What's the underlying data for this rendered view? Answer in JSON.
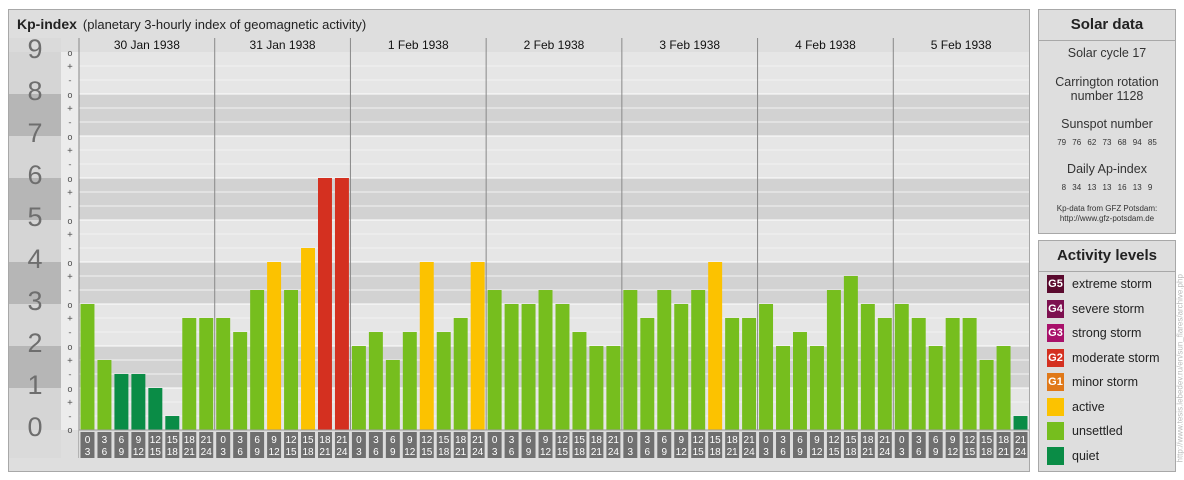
{
  "main": {
    "title": "Kp-index",
    "subtitle": "(planetary 3-hourly index of geomagnetic activity)"
  },
  "solar": {
    "header": "Solar data",
    "cycle": "Solar cycle 17",
    "carrington_line1": "Carrington rotation",
    "carrington_line2": "number 1128",
    "sunspot_label": "Sunspot number",
    "sunspot_values": "79 76 62 73 68 94 85",
    "ap_label": "Daily Ap-index",
    "ap_values": "8 34 13 13 16 13 9",
    "source_line1": "Kp-data from GFZ Potsdam:",
    "source_line2": "http://www.gfz-potsdam.de"
  },
  "levels": {
    "header": "Activity levels",
    "items": [
      {
        "code": "G5",
        "label": "extreme storm",
        "color": "#5a0a2e"
      },
      {
        "code": "G4",
        "label": "severe storm",
        "color": "#7d1050"
      },
      {
        "code": "G3",
        "label": "strong storm",
        "color": "#a8106a"
      },
      {
        "code": "G2",
        "label": "moderate storm",
        "color": "#d43020"
      },
      {
        "code": "G1",
        "label": "minor storm",
        "color": "#e07818"
      },
      {
        "code": "",
        "label": "active",
        "color": "#fcc200"
      },
      {
        "code": "",
        "label": "unsettled",
        "color": "#76be1e"
      },
      {
        "code": "",
        "label": "quiet",
        "color": "#0a8c46"
      }
    ]
  },
  "watermark": "http://www.tesis.lebedev.ru/en/sun_flares/archive.php",
  "chart_data": {
    "type": "bar",
    "ylim": [
      0,
      9
    ],
    "yticks": [
      "0",
      "1",
      "2",
      "3",
      "4",
      "5",
      "6",
      "7",
      "8",
      "9"
    ],
    "minor_tick_marks": [
      "-",
      "+",
      "o"
    ],
    "days": [
      "30 Jan 1938",
      "31 Jan 1938",
      "1 Feb 1938",
      "2 Feb 1938",
      "3 Feb 1938",
      "4 Feb 1938",
      "5 Feb 1938"
    ],
    "hour_starts": [
      "0",
      "3",
      "6",
      "9",
      "12",
      "15",
      "18",
      "21"
    ],
    "hour_ends": [
      "3",
      "6",
      "9",
      "12",
      "15",
      "18",
      "21",
      "24"
    ],
    "values": [
      [
        3,
        1.667,
        1.333,
        1.333,
        1,
        0.333,
        2.667,
        2.667
      ],
      [
        2.667,
        2.333,
        3.333,
        4,
        3.333,
        4.333,
        6,
        6
      ],
      [
        2,
        2.333,
        1.667,
        2.333,
        4,
        2.333,
        2.667,
        4
      ],
      [
        3.333,
        3,
        3,
        3.333,
        3,
        2.333,
        2,
        2
      ],
      [
        3.333,
        2.667,
        3.333,
        3,
        3.333,
        4,
        2.667,
        2.667
      ],
      [
        3,
        2,
        2.333,
        2,
        3.333,
        3.667,
        3,
        2.667
      ],
      [
        3,
        2.667,
        2,
        2.667,
        2.667,
        1.667,
        2,
        0.333
      ]
    ],
    "colors": {
      "quiet": "#0a8c46",
      "unsettled": "#76be1e",
      "active": "#fcc200",
      "minor": "#e07818",
      "moderate": "#d43020"
    }
  }
}
